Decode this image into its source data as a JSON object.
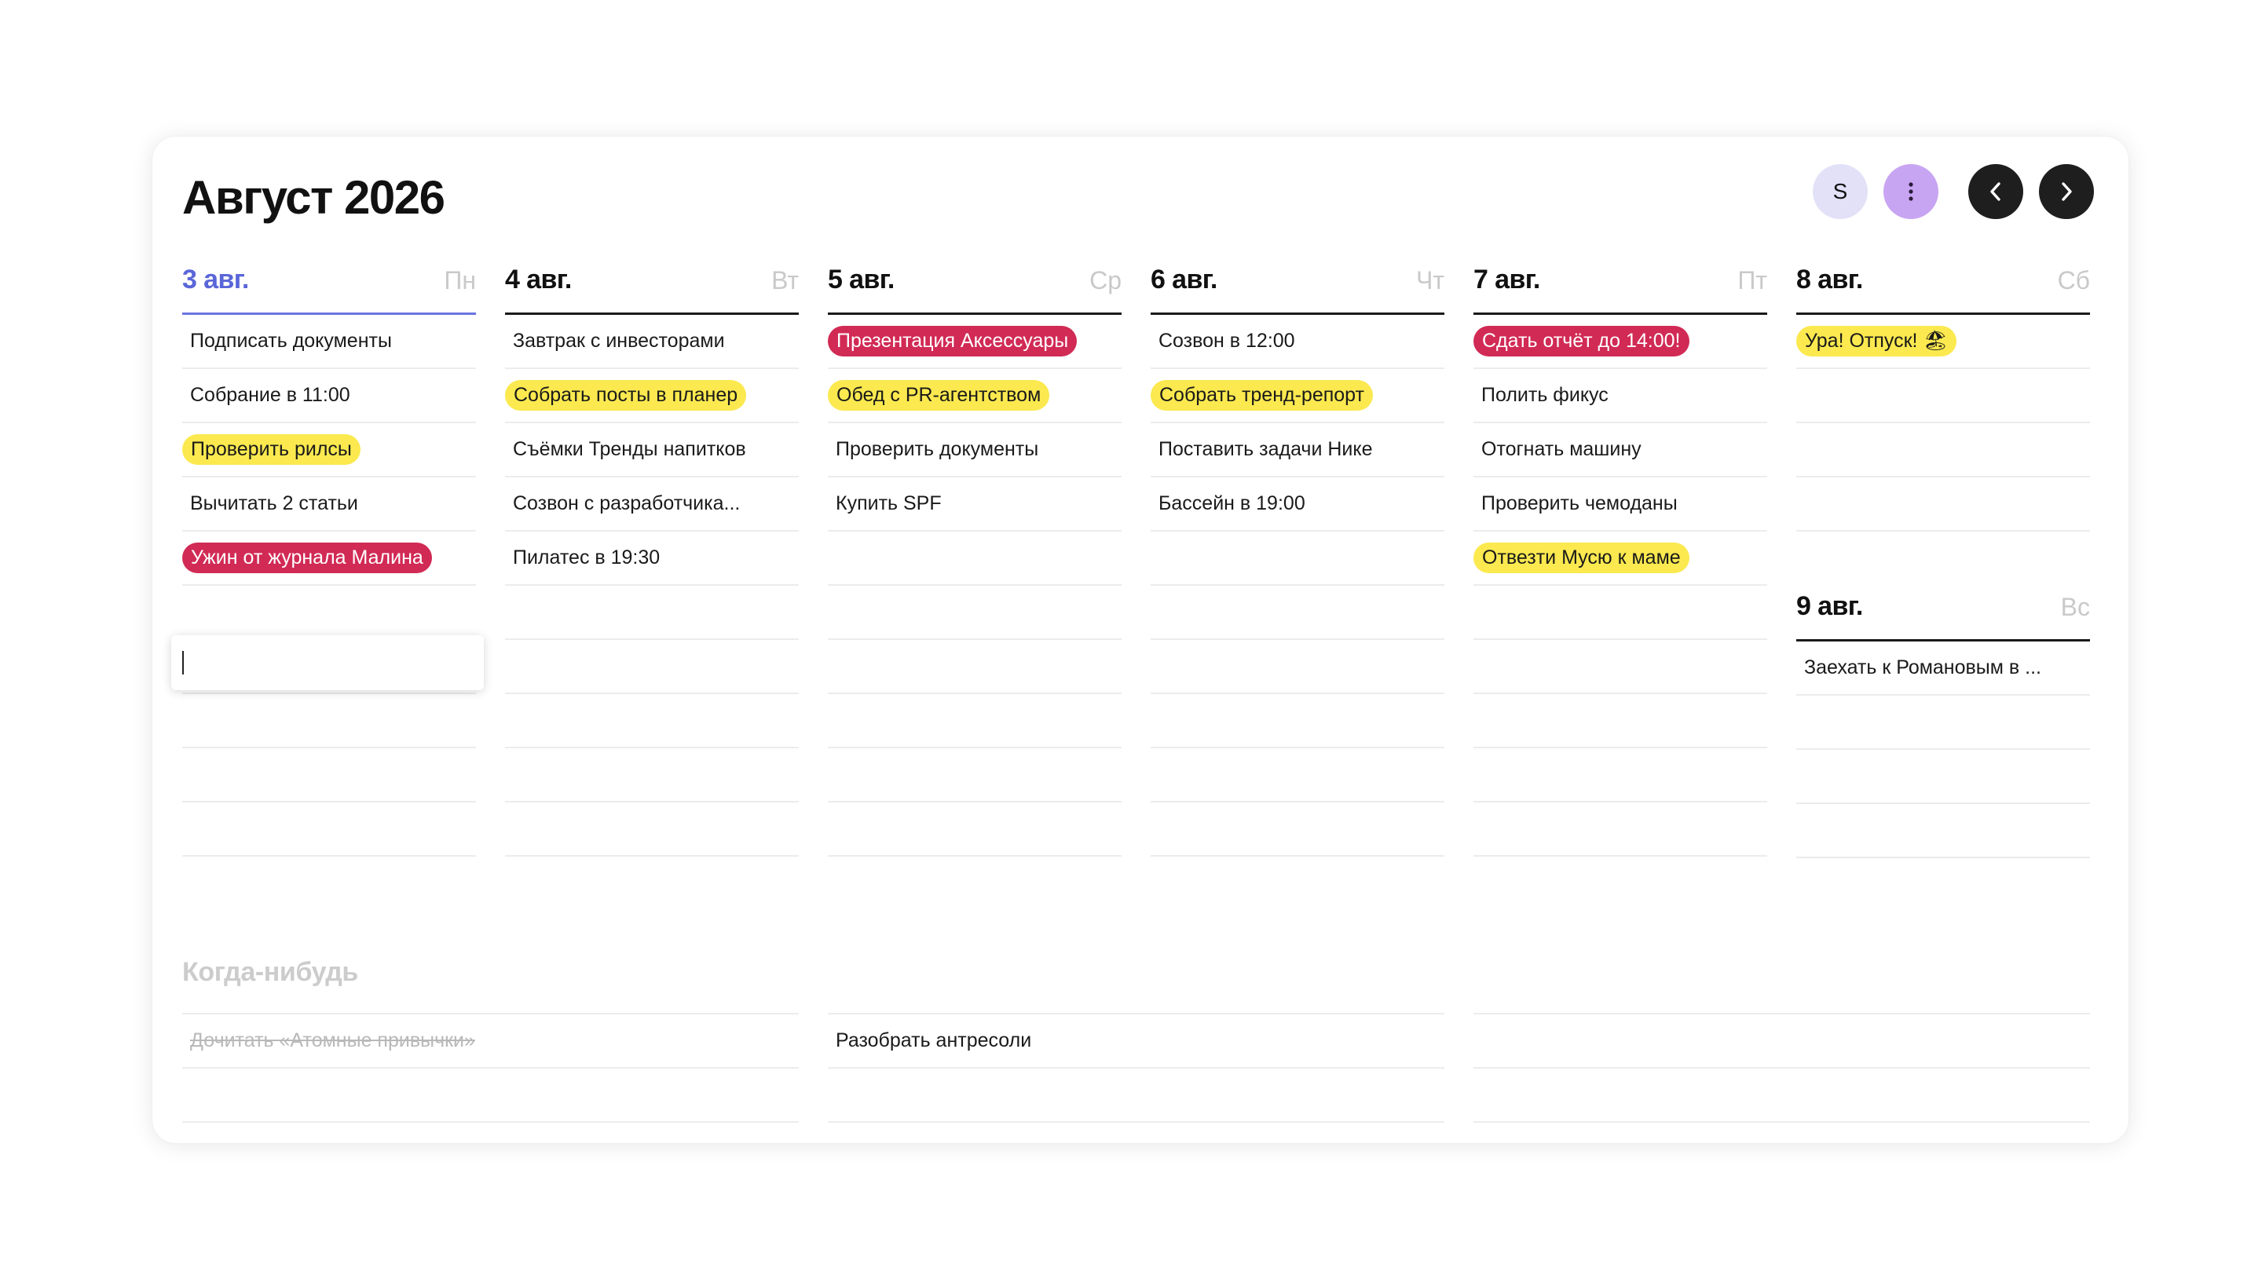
{
  "calendar": {
    "title": "Август 2026"
  },
  "header": {
    "user_initial": "S",
    "colors": {
      "user_bg": "#e2e1f8",
      "more_bg": "#c8a5f2",
      "nav_bg": "#1e1e1e"
    }
  },
  "colors": {
    "today_accent": "#5a66d8",
    "pill_yellow": "#fbe94f",
    "pill_red": "#d12a55"
  },
  "days": [
    {
      "date": "3 авг.",
      "weekday": "Пн",
      "today": true,
      "tasks": [
        {
          "text": "Подписать документы"
        },
        {
          "text": "Собрание в 11:00"
        },
        {
          "text": "Проверить рилсы",
          "highlight": "yellow"
        },
        {
          "text": "Вычитать 2 статьи"
        },
        {
          "text": "Ужин от журнала Малина",
          "highlight": "red"
        }
      ],
      "editing_input": ""
    },
    {
      "date": "4 авг.",
      "weekday": "Вт",
      "tasks": [
        {
          "text": "Завтрак с инвесторами"
        },
        {
          "text": "Собрать посты в планер",
          "highlight": "yellow"
        },
        {
          "text": "Съёмки Тренды напитков"
        },
        {
          "text": "Созвон с разработчика..."
        },
        {
          "text": "Пилатес в 19:30"
        }
      ]
    },
    {
      "date": "5 авг.",
      "weekday": "Ср",
      "tasks": [
        {
          "text": "Презентация Аксессуары",
          "highlight": "red"
        },
        {
          "text": "Обед с PR-агентством",
          "highlight": "yellow"
        },
        {
          "text": "Проверить документы"
        },
        {
          "text": "Купить SPF"
        }
      ]
    },
    {
      "date": "6 авг.",
      "weekday": "Чт",
      "tasks": [
        {
          "text": "Созвон в 12:00"
        },
        {
          "text": "Собрать тренд-репорт",
          "highlight": "yellow"
        },
        {
          "text": "Поставить задачи Нике"
        },
        {
          "text": "Бассейн в 19:00"
        }
      ]
    },
    {
      "date": "7 авг.",
      "weekday": "Пт",
      "tasks": [
        {
          "text": "Сдать отчёт до 14:00!",
          "highlight": "red"
        },
        {
          "text": "Полить фикус"
        },
        {
          "text": "Отогнать машину"
        },
        {
          "text": "Проверить чемоданы"
        },
        {
          "text": "Отвезти Мусю к маме",
          "highlight": "yellow"
        }
      ]
    },
    {
      "date": "8 авг.",
      "weekday": "Сб",
      "tasks": [
        {
          "text": "Ура! Отпуск! 🏖",
          "highlight": "yellow"
        }
      ]
    },
    {
      "date": "9 авг.",
      "weekday": "Вс",
      "tasks": [
        {
          "text": "Заехать к Романовым в ..."
        }
      ]
    }
  ],
  "someday": {
    "title": "Когда-нибудь",
    "columns": [
      {
        "tasks": [
          {
            "text": "Дочитать «Атомные привычки»",
            "done": true
          }
        ]
      },
      {
        "tasks": [
          {
            "text": "Разобрать антресоли"
          }
        ]
      },
      {
        "tasks": []
      }
    ]
  }
}
